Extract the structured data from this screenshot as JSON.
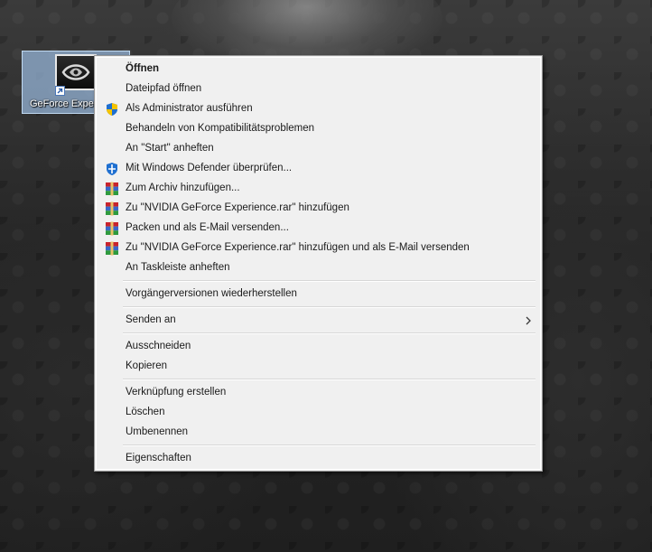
{
  "desktop": {
    "icon_label": "GeForce Experience"
  },
  "context_menu": {
    "items": [
      {
        "label": "Öffnen",
        "bold": true,
        "icon": "none"
      },
      {
        "label": "Dateipfad öffnen",
        "icon": "none"
      },
      {
        "label": "Als Administrator ausführen",
        "icon": "uac-shield-icon"
      },
      {
        "label": "Behandeln von Kompatibilitätsproblemen",
        "icon": "none"
      },
      {
        "label": "An \"Start\" anheften",
        "icon": "none"
      },
      {
        "label": "Mit Windows Defender überprüfen...",
        "icon": "windows-defender-icon"
      },
      {
        "label": "Zum Archiv hinzufügen...",
        "icon": "winrar-icon"
      },
      {
        "label": "Zu \"NVIDIA GeForce Experience.rar\" hinzufügen",
        "icon": "winrar-icon"
      },
      {
        "label": "Packen und als E-Mail versenden...",
        "icon": "winrar-icon"
      },
      {
        "label": "Zu \"NVIDIA GeForce Experience.rar\" hinzufügen und als E-Mail versenden",
        "icon": "winrar-icon"
      },
      {
        "label": "An Taskleiste anheften",
        "icon": "none"
      },
      {
        "label": "Vorgängerversionen wiederherstellen",
        "icon": "none"
      },
      {
        "label": "Senden an",
        "icon": "none",
        "submenu": true
      },
      {
        "label": "Ausschneiden",
        "icon": "none"
      },
      {
        "label": "Kopieren",
        "icon": "none"
      },
      {
        "label": "Verknüpfung erstellen",
        "icon": "none"
      },
      {
        "label": "Löschen",
        "icon": "none"
      },
      {
        "label": "Umbenennen",
        "icon": "none"
      },
      {
        "label": "Eigenschaften",
        "icon": "none"
      }
    ]
  },
  "colors": {
    "menu_background": "#f0f0f0",
    "menu_text": "#1a1a1a",
    "icon_selection": "#96b4d7",
    "winrar_red": "#c8232c",
    "shield_blue": "#1e6fd0",
    "shield_yellow": "#f5c400"
  }
}
